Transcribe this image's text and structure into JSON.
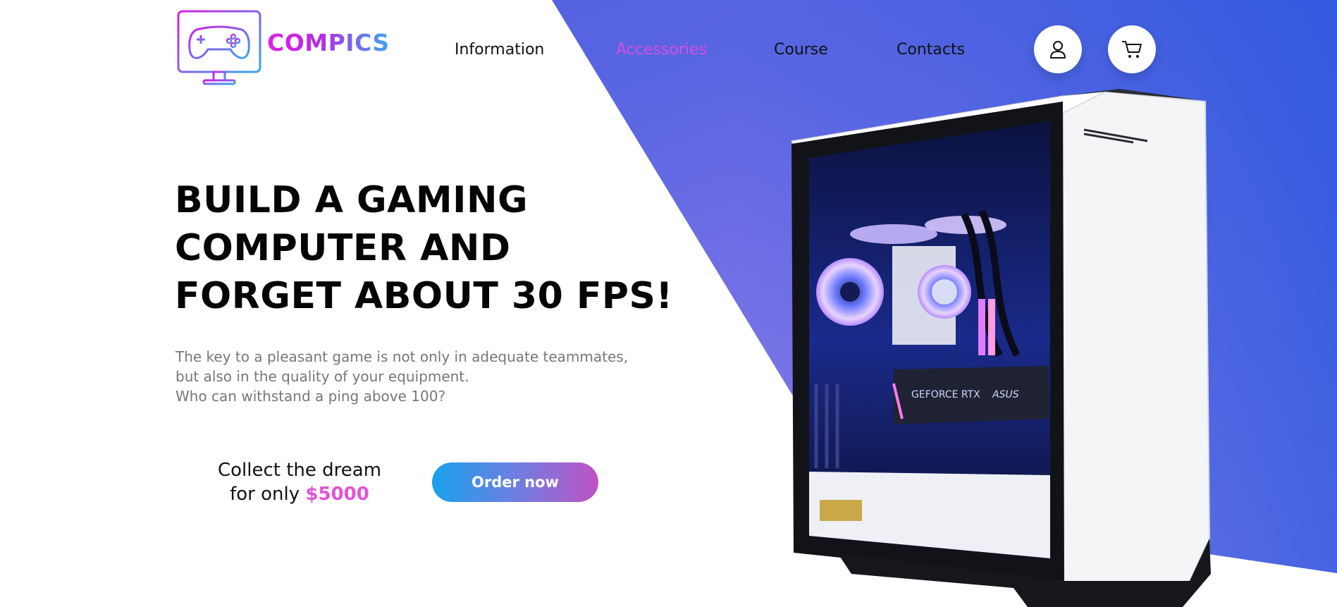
{
  "brand": {
    "name": "COMPICS",
    "logo_icon": "gamepad-monitor-icon"
  },
  "nav": {
    "items": [
      {
        "label": "Information",
        "active": false
      },
      {
        "label": "Accessories",
        "active": true
      },
      {
        "label": "Course",
        "active": false
      },
      {
        "label": "Contacts",
        "active": false
      }
    ],
    "active_color": "#d84fe0"
  },
  "header_actions": [
    {
      "icon": "user-icon"
    },
    {
      "icon": "cart-icon"
    }
  ],
  "hero": {
    "headline_lines": [
      "BUILD A GAMING",
      "COMPUTER AND",
      "FORGET ABOUT 30 FPS!"
    ],
    "lead_lines": [
      "The key to a pleasant game is not only in adequate teammates,",
      "but also in the quality of your equipment.",
      "Who can withstand a ping above 100?"
    ],
    "offer_line1": "Collect the dream",
    "offer_line2_prefix": "for only",
    "price": "$5000",
    "cta_label": "Order now"
  },
  "product_image": {
    "subject": "white gaming pc case with blue-lit components",
    "gpu_label": "GEFORCE RTX",
    "brand_label": "ASUS"
  },
  "colors": {
    "accent_pink": "#e153d8",
    "gradient_blue": "#1aa1ec",
    "background_purple": "#7c74e6"
  }
}
